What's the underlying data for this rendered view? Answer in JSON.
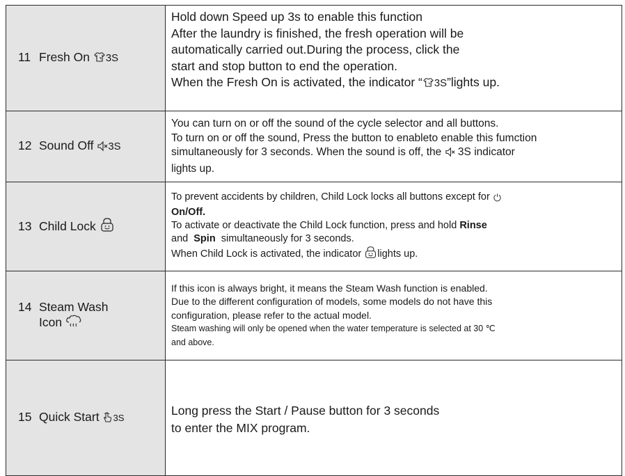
{
  "rows": [
    {
      "number": "11",
      "name": "Fresh On",
      "icon": "fresh-shirt-icon",
      "icon_text": "3S",
      "description": [
        "Hold down Speed up 3s to enable this function",
        "After the laundry is finished, the fresh operation will be",
        "automatically carried out.During the process, click the",
        "start and stop button to end the operation."
      ],
      "last_line": {
        "before": "When the Fresh On is activated, the indicator “",
        "icon_text": "3S",
        "after": "”lights up."
      }
    },
    {
      "number": "12",
      "name": "Sound Off",
      "icon": "sound-off-icon",
      "icon_text": "3S",
      "description": [
        "You can turn on or off the sound of the cycle selector and all buttons.",
        "To turn on or off the sound, Press the button to enableto enable this fumction"
      ],
      "line3": {
        "before": "simultaneously for 3 seconds. When the sound is off, the",
        "icon_text": "3S",
        "after": "indicator"
      },
      "line4": "lights up."
    },
    {
      "number": "13",
      "name": "Child Lock",
      "icon": "child-lock-icon",
      "line1": "To prevent accidents by children, Child Lock locks all buttons except for",
      "line1_icon": "power-icon",
      "line2_bold": "On/Off.",
      "line3_before": "To activate or deactivate the Child Lock function, press and hold",
      "line3_bold": "Rinse",
      "line4_before": "and",
      "line4_bold": "Spin",
      "line4_after": "simultaneously for 3 seconds.",
      "line5_before": "When Child Lock is activated, the indicator",
      "line5_after": "lights up."
    },
    {
      "number": "14",
      "name_line1": "Steam Wash",
      "name_line2": "Icon",
      "icon": "steam-icon",
      "description": [
        "If this icon is always bright, it means the Steam Wash function is enabled.",
        "Due to the different configuration of models, some models do not have this",
        "configuration, please refer to the actual model."
      ],
      "note": [
        "Steam washing will only be opened when the water temperature is selected at 30 ℃",
        "and above."
      ]
    },
    {
      "number": "15",
      "name": "Quick Start",
      "icon": "hand-press-icon",
      "icon_text": "3S",
      "description": [
        "Long press the Start / Pause button for 3 seconds",
        "to enter the MIX program."
      ]
    }
  ]
}
